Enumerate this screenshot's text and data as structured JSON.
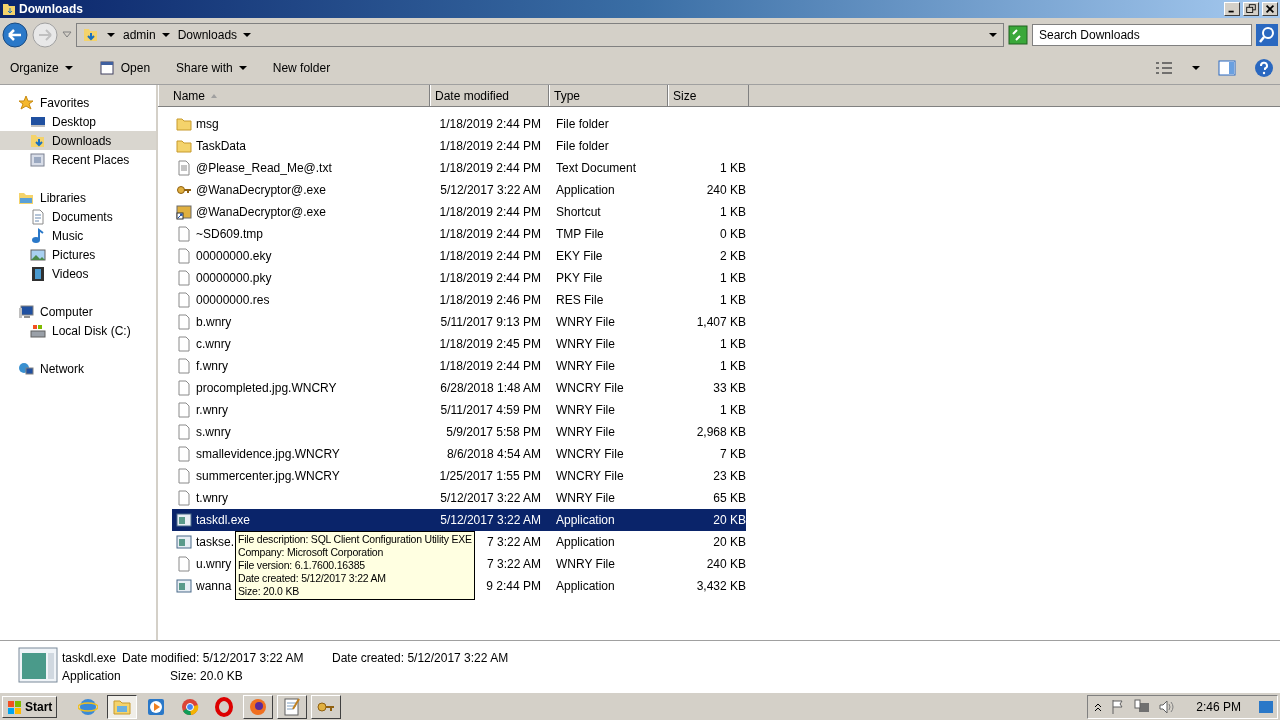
{
  "window": {
    "title": "Downloads"
  },
  "address": {
    "crumbs": [
      "admin",
      "Downloads"
    ],
    "search_placeholder": "Search Downloads"
  },
  "toolbar": {
    "buttons": [
      {
        "label": "Organize",
        "kind": "menu"
      },
      {
        "label": "Open",
        "kind": "open"
      },
      {
        "label": "Share with",
        "kind": "menu"
      },
      {
        "label": "New folder",
        "kind": "plain"
      }
    ]
  },
  "sidebar": {
    "groups": [
      {
        "label": "Favorites",
        "kind": "star",
        "children": [
          {
            "label": "Desktop",
            "kind": "desktop",
            "selected": false
          },
          {
            "label": "Downloads",
            "kind": "downloads",
            "selected": true
          },
          {
            "label": "Recent Places",
            "kind": "recent",
            "selected": false
          }
        ]
      },
      {
        "label": "Libraries",
        "kind": "library",
        "children": [
          {
            "label": "Documents",
            "kind": "documents",
            "selected": false
          },
          {
            "label": "Music",
            "kind": "music",
            "selected": false
          },
          {
            "label": "Pictures",
            "kind": "pictures",
            "selected": false
          },
          {
            "label": "Videos",
            "kind": "videos",
            "selected": false
          }
        ]
      },
      {
        "label": "Computer",
        "kind": "computer",
        "children": [
          {
            "label": "Local Disk (C:)",
            "kind": "disk",
            "selected": false
          }
        ]
      },
      {
        "label": "Network",
        "kind": "network"
      }
    ]
  },
  "table": {
    "columns": [
      "Name",
      "Date modified",
      "Type",
      "Size"
    ],
    "rows": [
      {
        "name": "msg",
        "date": "1/18/2019 2:44 PM",
        "type": "File folder",
        "kind": "folder",
        "selected": false
      },
      {
        "name": "TaskData",
        "date": "1/18/2019 2:44 PM",
        "type": "File folder",
        "kind": "folder",
        "selected": false
      },
      {
        "name": "@Please_Read_Me@.txt",
        "date": "1/18/2019 2:44 PM",
        "type": "Text Document",
        "size": "1 KB",
        "kind": "text",
        "selected": false
      },
      {
        "name": "@WanaDecryptor@.exe",
        "date": "5/12/2017 3:22 AM",
        "type": "Application",
        "size": "240 KB",
        "kind": "keys",
        "selected": false
      },
      {
        "name": "@WanaDecryptor@.exe",
        "date": "1/18/2019 2:44 PM",
        "type": "Shortcut",
        "size": "1 KB",
        "kind": "shortcut",
        "selected": false
      },
      {
        "name": "~SD609.tmp",
        "date": "1/18/2019 2:44 PM",
        "type": "TMP File",
        "size": "0 KB",
        "kind": "file",
        "selected": false
      },
      {
        "name": "00000000.eky",
        "date": "1/18/2019 2:44 PM",
        "type": "EKY File",
        "size": "2 KB",
        "kind": "file",
        "selected": false
      },
      {
        "name": "00000000.pky",
        "date": "1/18/2019 2:44 PM",
        "type": "PKY File",
        "size": "1 KB",
        "kind": "file",
        "selected": false
      },
      {
        "name": "00000000.res",
        "date": "1/18/2019 2:46 PM",
        "type": "RES File",
        "size": "1 KB",
        "kind": "file",
        "selected": false
      },
      {
        "name": "b.wnry",
        "date": "5/11/2017 9:13 PM",
        "type": "WNRY File",
        "size": "1,407 KB",
        "kind": "file",
        "selected": false
      },
      {
        "name": "c.wnry",
        "date": "1/18/2019 2:45 PM",
        "type": "WNRY File",
        "size": "1 KB",
        "kind": "file",
        "selected": false
      },
      {
        "name": "f.wnry",
        "date": "1/18/2019 2:44 PM",
        "type": "WNRY File",
        "size": "1 KB",
        "kind": "file",
        "selected": false
      },
      {
        "name": "procompleted.jpg.WNCRY",
        "date": "6/28/2018 1:48 AM",
        "type": "WNCRY File",
        "size": "33 KB",
        "kind": "file",
        "selected": false
      },
      {
        "name": "r.wnry",
        "date": "5/11/2017 4:59 PM",
        "type": "WNRY File",
        "size": "1 KB",
        "kind": "file",
        "selected": false
      },
      {
        "name": "s.wnry",
        "date": "5/9/2017 5:58 PM",
        "type": "WNRY File",
        "size": "2,968 KB",
        "kind": "file",
        "selected": false
      },
      {
        "name": "smallevidence.jpg.WNCRY",
        "date": "8/6/2018 4:54 AM",
        "type": "WNCRY File",
        "size": "7 KB",
        "kind": "file",
        "selected": false
      },
      {
        "name": "summercenter.jpg.WNCRY",
        "date": "1/25/2017 1:55 PM",
        "type": "WNCRY File",
        "size": "23 KB",
        "kind": "file",
        "selected": false
      },
      {
        "name": "t.wnry",
        "date": "5/12/2017 3:22 AM",
        "type": "WNRY File",
        "size": "65 KB",
        "kind": "file",
        "selected": false
      },
      {
        "name": "taskdl.exe",
        "date": "5/12/2017 3:22 AM",
        "type": "Application",
        "size": "20 KB",
        "kind": "app",
        "selected": true
      },
      {
        "name": "taskse.",
        "date": "7 3:22 AM",
        "type": "Application",
        "size": "20 KB",
        "kind": "app",
        "selected": false
      },
      {
        "name": "u.wnry",
        "date": "7 3:22 AM",
        "type": "WNRY File",
        "size": "240 KB",
        "kind": "file",
        "selected": false
      },
      {
        "name": "wanna",
        "date": "9 2:44 PM",
        "type": "Application",
        "size": "3,432 KB",
        "kind": "app",
        "selected": false
      }
    ]
  },
  "tooltip": {
    "lines": [
      "File description: SQL Client Configuration Utility EXE",
      "Company: Microsoft Corporation",
      "File version: 6.1.7600.16385",
      "Date created: 5/12/2017 3:22 AM",
      "Size: 20.0 KB"
    ]
  },
  "details": {
    "name": "taskdl.exe",
    "type": "Application",
    "fields": [
      {
        "label": "Date modified:",
        "value": "5/12/2017 3:22 AM"
      },
      {
        "label": "Size:",
        "value": "20.0 KB"
      },
      {
        "label": "Date created:",
        "value": "5/12/2017 3:22 AM"
      }
    ]
  },
  "taskbar": {
    "start": "Start",
    "apps": [
      {
        "kind": "ie",
        "running": false,
        "selected": false
      },
      {
        "kind": "explorer",
        "running": true,
        "selected": true
      },
      {
        "kind": "media",
        "running": false,
        "selected": false
      },
      {
        "kind": "chrome",
        "running": false,
        "selected": false
      },
      {
        "kind": "opera",
        "running": false,
        "selected": false
      },
      {
        "kind": "firefox",
        "running": true,
        "selected": false
      },
      {
        "kind": "notepad",
        "running": true,
        "selected": false
      },
      {
        "kind": "keys",
        "running": true,
        "selected": false
      }
    ],
    "clock": "2:46 PM"
  }
}
